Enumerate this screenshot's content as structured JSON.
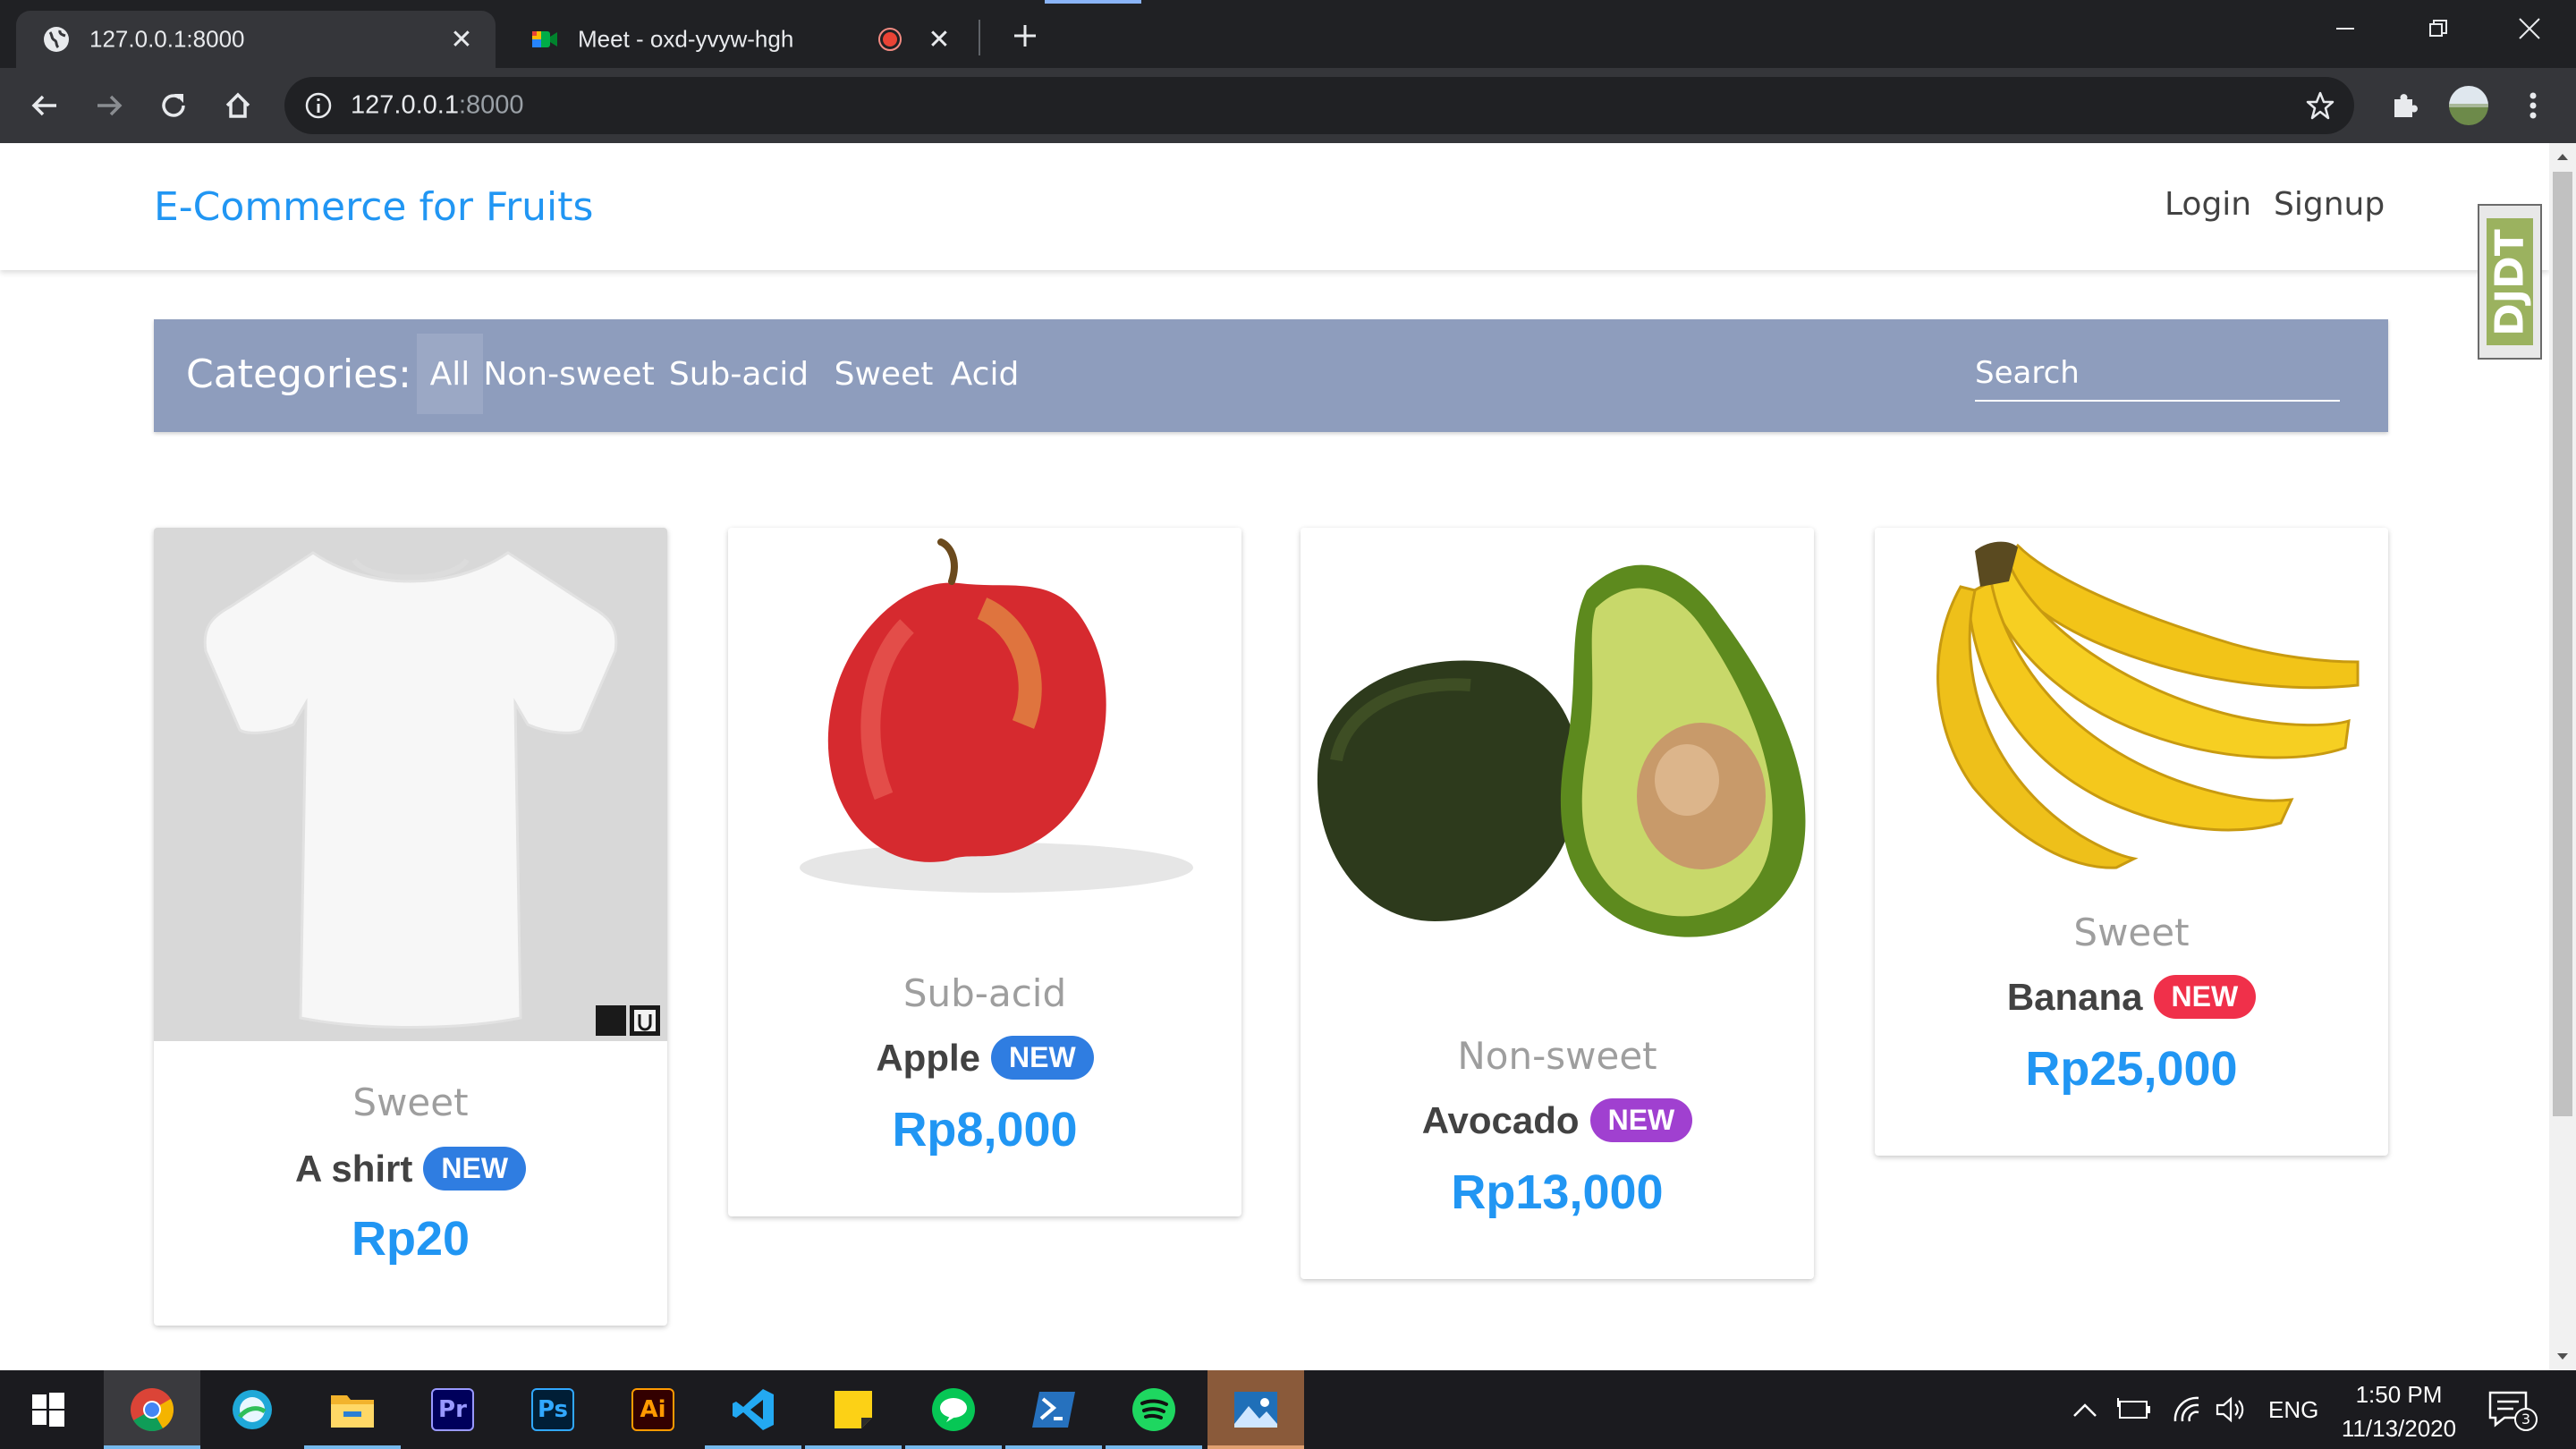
{
  "browser": {
    "tabs": [
      {
        "title": "127.0.0.1:8000",
        "active": true
      },
      {
        "title": "Meet - oxd-yvyw-hgh",
        "active": false
      }
    ],
    "url_host": "127.0.0.1",
    "url_port": ":8000"
  },
  "site": {
    "brand": "E-Commerce for Fruits",
    "nav": {
      "login": "Login",
      "signup": "Signup"
    }
  },
  "categories": {
    "label": "Categories:",
    "items": [
      "All",
      "Non-sweet",
      "Sub-acid",
      "Sweet",
      "Acid"
    ],
    "selected": "All",
    "search_placeholder": "Search"
  },
  "products": [
    {
      "category": "Sweet",
      "name": "A shirt",
      "badge": "NEW",
      "badge_color": "#2f7de1",
      "price": "Rp20",
      "image": "white-tshirt",
      "image_text": "UNI QLO"
    },
    {
      "category": "Sub-acid",
      "name": "Apple",
      "badge": "NEW",
      "badge_color": "#2f7de1",
      "price": "Rp8,000",
      "image": "red-apple"
    },
    {
      "category": "Non-sweet",
      "name": "Avocado",
      "badge": "NEW",
      "badge_color": "#a040d0",
      "price": "Rp13,000",
      "image": "avocado"
    },
    {
      "category": "Sweet",
      "name": "Banana",
      "badge": "NEW",
      "badge_color": "#f0304a",
      "price": "Rp25,000",
      "image": "banana-bunch"
    }
  ],
  "extension_badge": "DJDT",
  "taskbar": {
    "apps": [
      "windows-start",
      "chrome",
      "browser-app",
      "file-explorer",
      "premiere-pro",
      "photoshop",
      "illustrator",
      "vs-code",
      "sticky-notes",
      "line",
      "powershell",
      "spotify",
      "photos"
    ],
    "app_labels": {
      "premiere": "Pr",
      "photoshop": "Ps",
      "illustrator": "Ai"
    },
    "language": "ENG",
    "time": "1:50 PM",
    "date": "11/13/2020",
    "notifications": "3"
  },
  "colors": {
    "accent": "#2196f3",
    "category_bar": "#8e9dbd",
    "text_dark": "#424242"
  }
}
